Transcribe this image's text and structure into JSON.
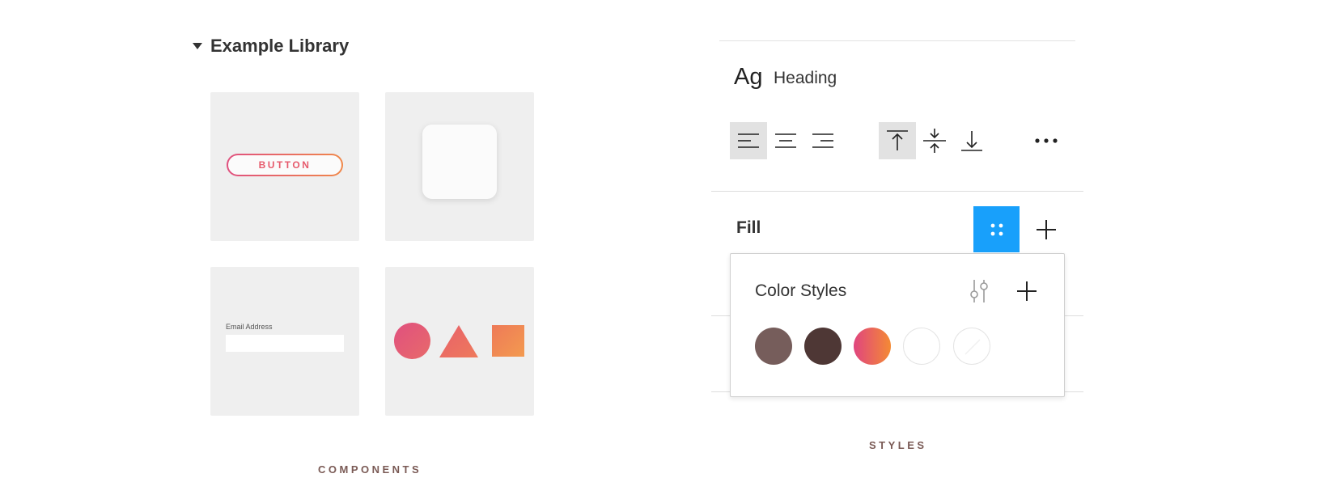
{
  "library": {
    "title": "Example Library",
    "caption": "COMPONENTS",
    "button_sample_label": "BUTTON",
    "email_label": "Email Address"
  },
  "styles": {
    "caption": "STYLES",
    "text_style": {
      "preview": "Ag",
      "name": "Heading"
    },
    "fill": {
      "label": "Fill"
    },
    "color_styles": {
      "title": "Color Styles",
      "swatches": [
        "#765d5b",
        "#4e3735",
        "gradient:#e0457f-#f48a34",
        "#ffffff",
        "transparent"
      ]
    }
  },
  "colors": {
    "accent": "#18a0fb",
    "caption": "#7a5a55"
  }
}
